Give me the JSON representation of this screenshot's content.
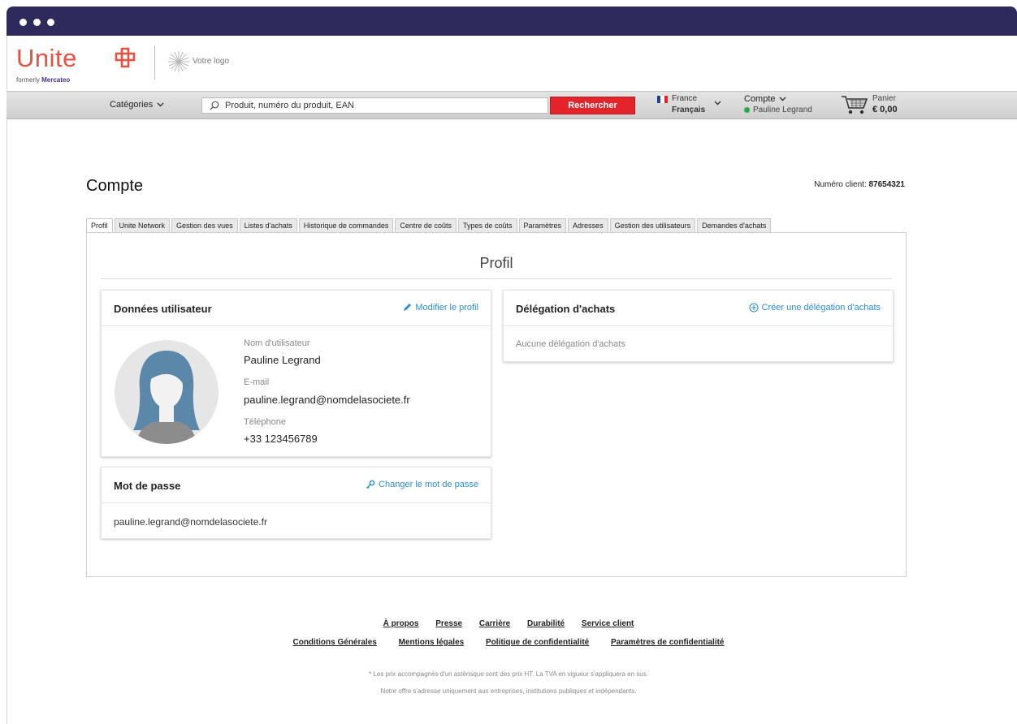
{
  "brand": {
    "name": "Unite",
    "formerly": "formerly",
    "former_name": "Mercateo",
    "custom_logo_text": "Votre logo"
  },
  "navbar": {
    "categories_label": "Catégories",
    "search_placeholder": "Produit, numéro du produit, EAN",
    "search_button": "Rechercher",
    "country": "France",
    "language": "Français",
    "account_label": "Compte",
    "account_user": "Pauline Legrand",
    "cart_label": "Panier",
    "cart_total": "€ 0,00"
  },
  "page": {
    "title": "Compte",
    "client_number_label": "Numéro client:",
    "client_number": "87654321"
  },
  "tabs": [
    {
      "label": "Profil",
      "active": true
    },
    {
      "label": "Unite Network"
    },
    {
      "label": "Gestion des vues"
    },
    {
      "label": "Listes d'achats"
    },
    {
      "label": "Historique de commandes"
    },
    {
      "label": "Centre de coûts"
    },
    {
      "label": "Types de coûts"
    },
    {
      "label": "Paramètres"
    },
    {
      "label": "Adresses"
    },
    {
      "label": "Gestion des utilisateurs"
    },
    {
      "label": "Demandes d'achats"
    }
  ],
  "profile": {
    "section_title": "Profil",
    "user_data": {
      "title": "Données utilisateur",
      "edit_action": "Modifier le profil",
      "username_label": "Nom d'utilisateur",
      "username": "Pauline Legrand",
      "email_label": "E-mail",
      "email": "pauline.legrand@nomdelasociete.fr",
      "phone_label": "Téléphone",
      "phone": "+33 123456789"
    },
    "password": {
      "title": "Mot de passe",
      "change_action": "Changer le mot de passe",
      "login": "pauline.legrand@nomdelasociete.fr"
    },
    "delegation": {
      "title": "Délégation d'achats",
      "create_action": "Créer une délégation d'achats",
      "empty_text": "Aucune délégation d'achats"
    }
  },
  "footer": {
    "row1": [
      "À propos",
      "Presse",
      "Carrière",
      "Durabilité",
      "Service client"
    ],
    "row2": [
      "Conditions Générales",
      "Mentions légales",
      "Politique de confidentialité",
      "Paramètres de confidentialité"
    ],
    "note1": "* Les prix accompagnés d'un astérisque sont des prix HT. La TVA en vigueur s'appliquera en sus.",
    "note2": "Notre offre s'adresse uniquement aux entreprises, institutions publiques et indépendants."
  },
  "colors": {
    "window_bar": "#2e2a5c",
    "brand_red": "#e8513f",
    "brand_purple": "#4b2e83",
    "search_button": "#e3252b",
    "link_blue": "#2b8cd8",
    "avatar_hair": "#5b87a8",
    "status_green": "#2aa84a"
  },
  "icons": {
    "brand_mark": "plus-knot-icon",
    "custom_logo": "sunburst-icon",
    "categories": "chevron-down-icon",
    "search": "search-icon",
    "flag": "french-flag-icon",
    "cart": "shopping-cart-icon",
    "edit": "pencil-icon",
    "password": "key-icon",
    "create": "plus-circle-icon",
    "avatar": "user-avatar-icon"
  }
}
